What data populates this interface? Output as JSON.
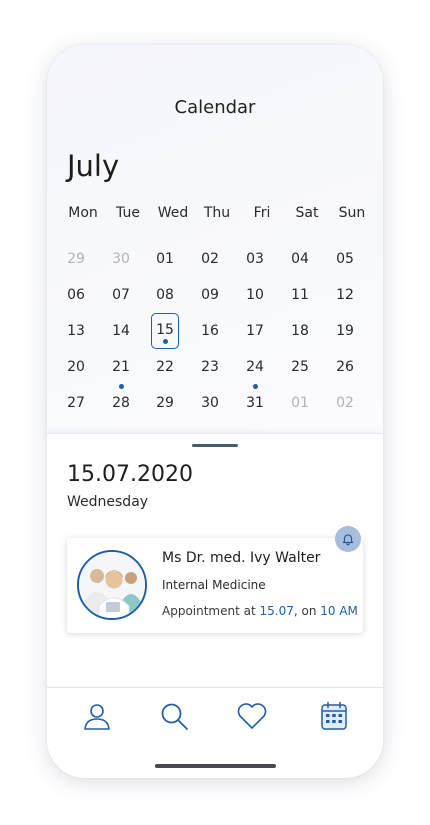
{
  "screen_title": "Calendar",
  "calendar": {
    "month": "July",
    "weekdays": [
      "Mon",
      "Tue",
      "Wed",
      "Thu",
      "Fri",
      "Sat",
      "Sun"
    ],
    "weeks": [
      [
        {
          "d": "29",
          "muted": true
        },
        {
          "d": "30",
          "muted": true
        },
        {
          "d": "01"
        },
        {
          "d": "02"
        },
        {
          "d": "03"
        },
        {
          "d": "04"
        },
        {
          "d": "05"
        }
      ],
      [
        {
          "d": "06"
        },
        {
          "d": "07"
        },
        {
          "d": "08"
        },
        {
          "d": "09"
        },
        {
          "d": "10"
        },
        {
          "d": "11"
        },
        {
          "d": "12"
        }
      ],
      [
        {
          "d": "13"
        },
        {
          "d": "14"
        },
        {
          "d": "15",
          "selected": true,
          "event": true
        },
        {
          "d": "16"
        },
        {
          "d": "17"
        },
        {
          "d": "18"
        },
        {
          "d": "19"
        }
      ],
      [
        {
          "d": "20"
        },
        {
          "d": "21",
          "event": true
        },
        {
          "d": "22"
        },
        {
          "d": "23"
        },
        {
          "d": "24",
          "event": true
        },
        {
          "d": "25"
        },
        {
          "d": "26"
        }
      ],
      [
        {
          "d": "27"
        },
        {
          "d": "28"
        },
        {
          "d": "29"
        },
        {
          "d": "30"
        },
        {
          "d": "31"
        },
        {
          "d": "01",
          "muted": true
        },
        {
          "d": "02",
          "muted": true
        }
      ]
    ]
  },
  "selected_day": {
    "date": "15.07.2020",
    "weekday": "Wednesday"
  },
  "appointment": {
    "doctor_name": "Ms Dr. med. Ivy Walter",
    "specialty": "Internal Medicine",
    "text_prefix": "Appointment at ",
    "date": "15.07",
    "text_mid": ", on ",
    "time": "10 AM",
    "reminder_icon": "bell-icon"
  },
  "tabbar": {
    "items": [
      {
        "icon": "profile-icon"
      },
      {
        "icon": "search-icon"
      },
      {
        "icon": "heart-icon"
      },
      {
        "icon": "calendar-icon",
        "active": true
      }
    ]
  },
  "colors": {
    "accent": "#1f5ea8",
    "muted_text": "#b3b3b7",
    "reminder_badge": "#a7bddb"
  }
}
